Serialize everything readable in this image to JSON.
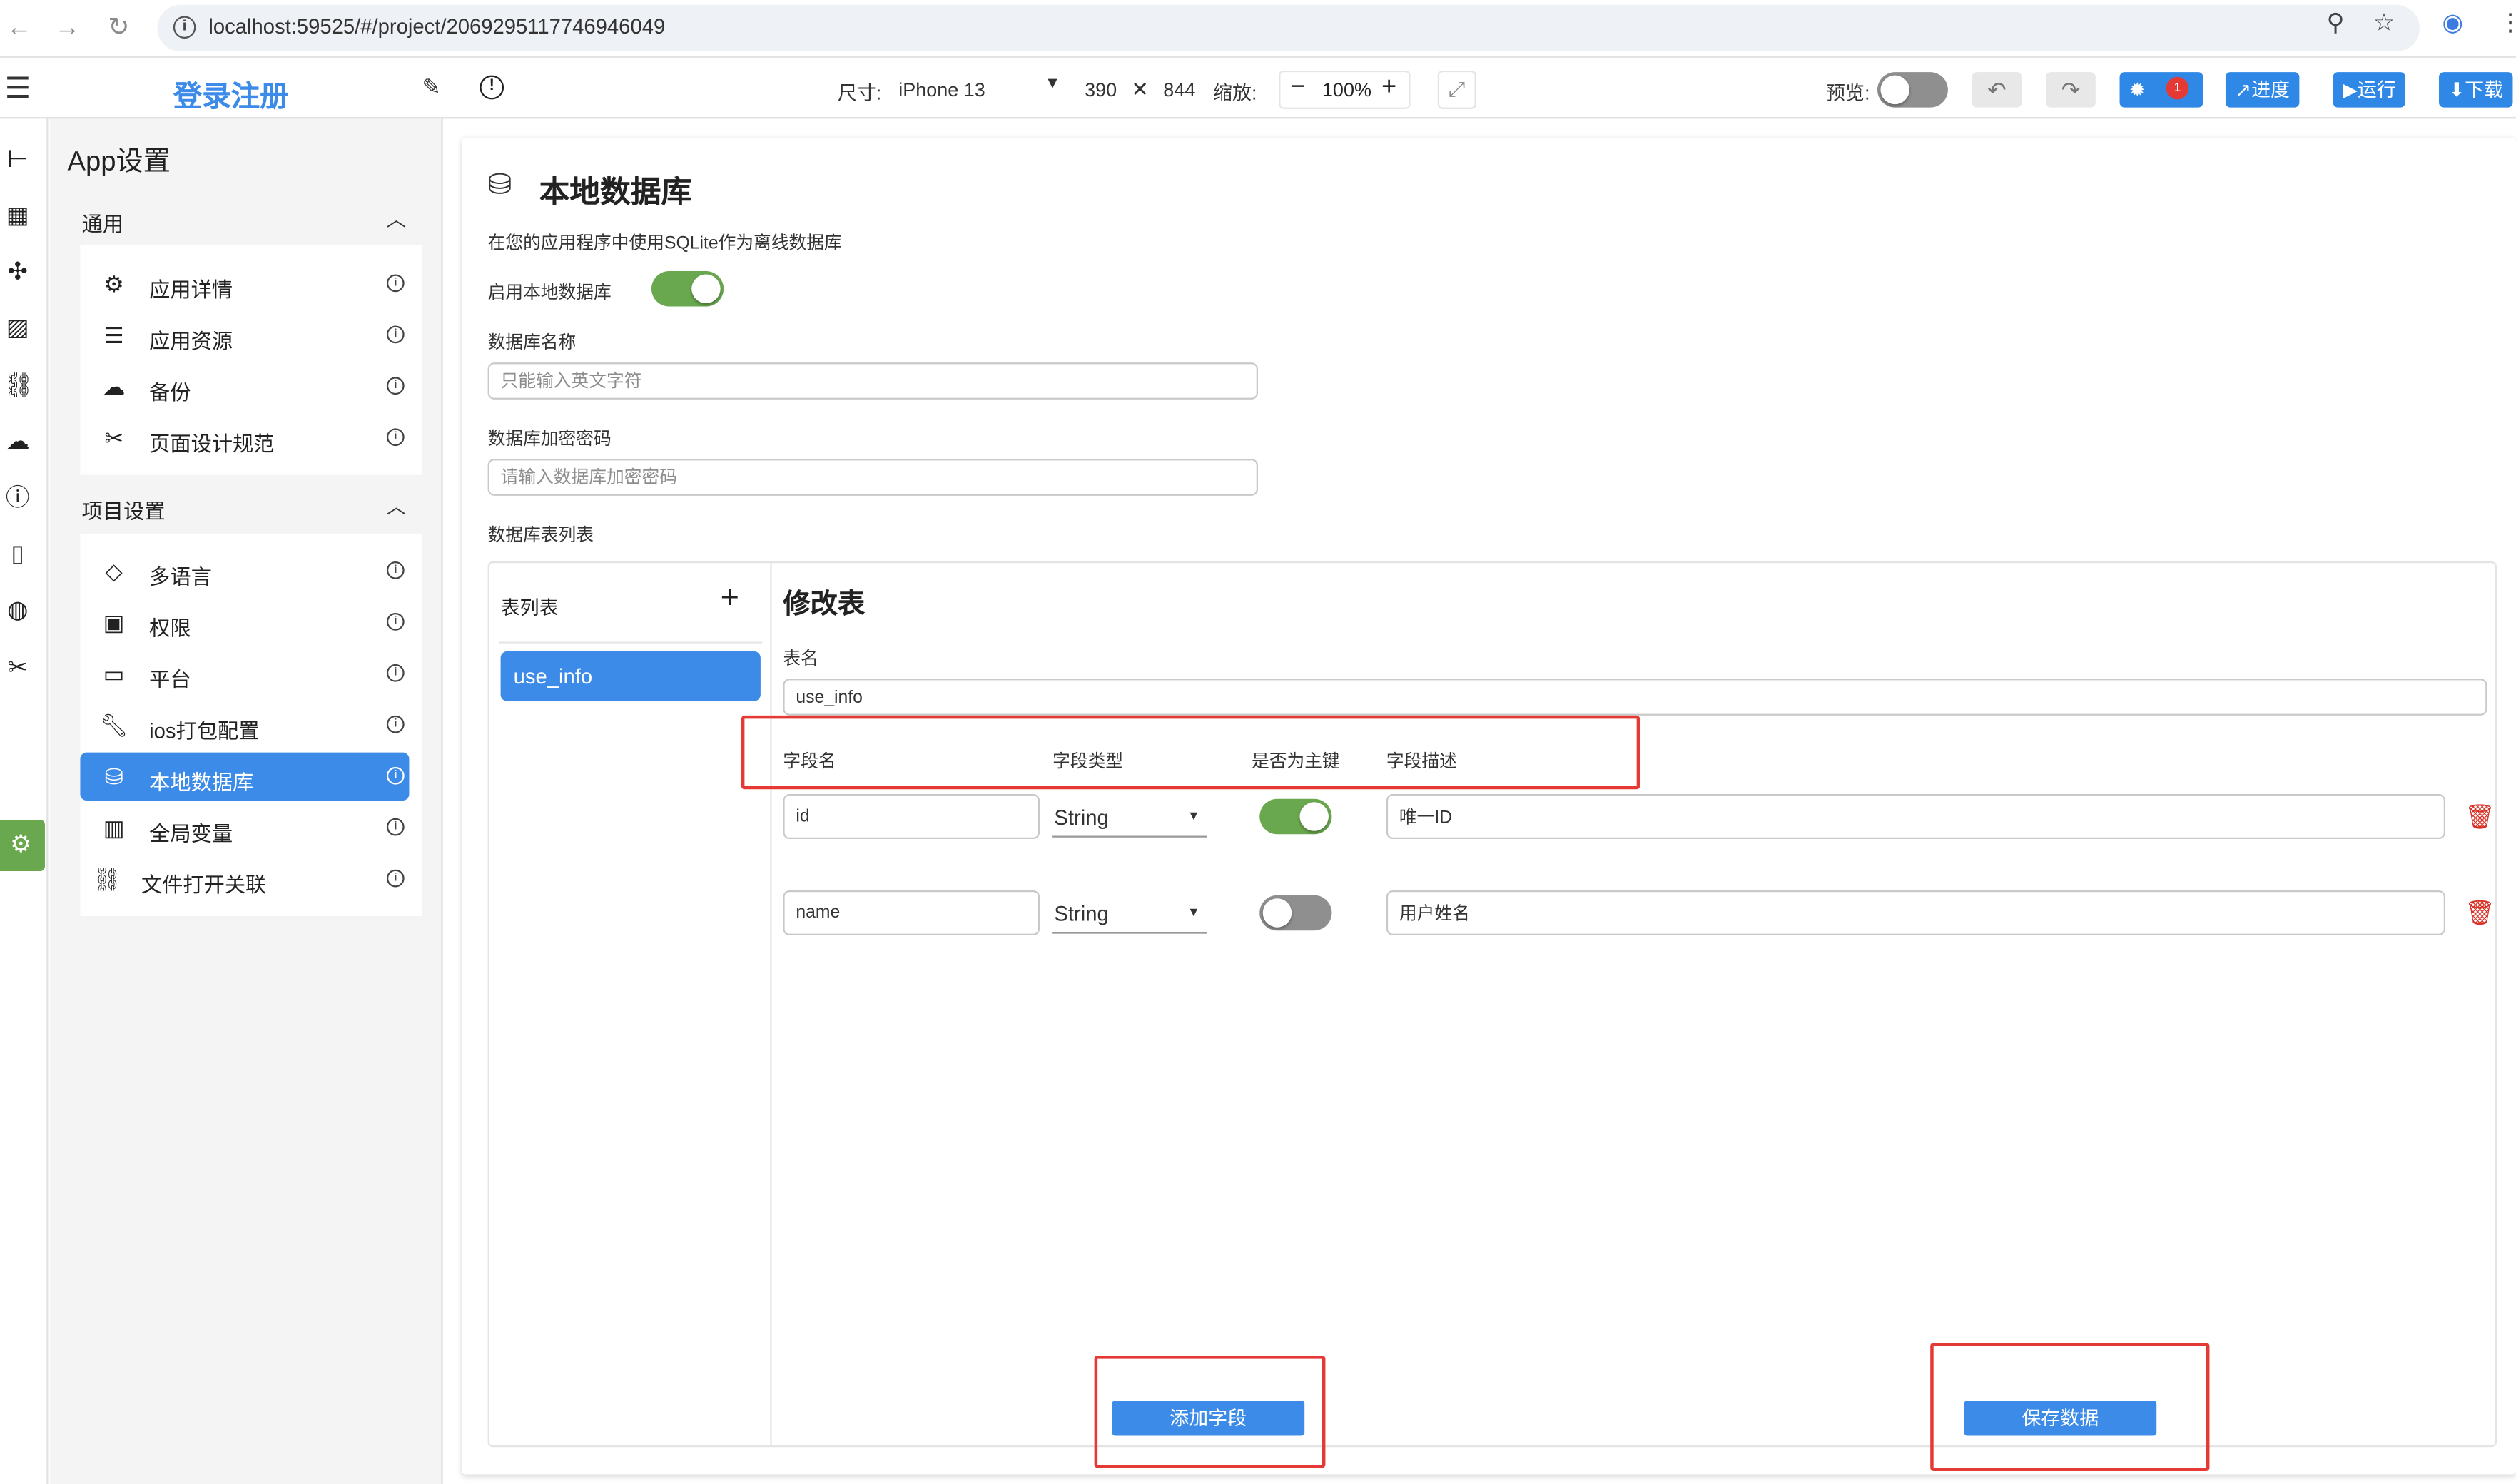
{
  "browser": {
    "url": "localhost:59525/#/project/2069295117746946049"
  },
  "toolbar": {
    "project_name": "登录注册",
    "size_label": "尺寸:",
    "device": "iPhone 13",
    "width": "390",
    "times": "✕",
    "height": "844",
    "zoom_label": "缩放:",
    "zoom_value": "100%",
    "preview_label": "预览:",
    "bug_count": "1",
    "progress_label": "进度",
    "run_label": "运行",
    "download_label": "下载",
    "accent_color": "#2f88e6"
  },
  "settings": {
    "title": "App设置",
    "general": {
      "header": "通用",
      "items": [
        {
          "label": "应用详情",
          "icon": "gear-cog-icon"
        },
        {
          "label": "应用资源",
          "icon": "list-check-icon"
        },
        {
          "label": "备份",
          "icon": "cloud-upload-icon"
        },
        {
          "label": "页面设计规范",
          "icon": "design-tools-icon"
        }
      ]
    },
    "project": {
      "header": "项目设置",
      "items": [
        {
          "label": "多语言",
          "icon": "translate-icon"
        },
        {
          "label": "权限",
          "icon": "lock-icon"
        },
        {
          "label": "平台",
          "icon": "devices-icon"
        },
        {
          "label": "ios打包配置",
          "icon": "wrench-icon"
        },
        {
          "label": "本地数据库",
          "icon": "database-icon"
        },
        {
          "label": "全局变量",
          "icon": "variable-icon"
        },
        {
          "label": "文件打开关联",
          "icon": "link-icon"
        }
      ]
    }
  },
  "database": {
    "title": "本地数据库",
    "description": "在您的应用程序中使用SQLite作为离线数据库",
    "enable_label": "启用本地数据库",
    "enabled": true,
    "name_label": "数据库名称",
    "name_placeholder": "只能输入英文字符",
    "password_label": "数据库加密密码",
    "password_placeholder": "请输入数据库加密密码",
    "tables_label": "数据库表列表",
    "table_list": {
      "title": "表列表",
      "items": [
        "use_info"
      ]
    },
    "edit": {
      "title": "修改表",
      "table_name_label": "表名",
      "table_name": "use_info",
      "columns": {
        "field_name": "字段名",
        "field_type": "字段类型",
        "primary_key": "是否为主键",
        "description": "字段描述"
      },
      "fields": [
        {
          "name": "id",
          "type": "String",
          "primary": true,
          "description": "唯一ID"
        },
        {
          "name": "name",
          "type": "String",
          "primary": false,
          "description": "用户姓名"
        }
      ],
      "add_field_label": "添加字段",
      "save_label": "保存数据"
    },
    "toggle_on_color": "#6aa84f",
    "annotation_color": "#e53935"
  }
}
